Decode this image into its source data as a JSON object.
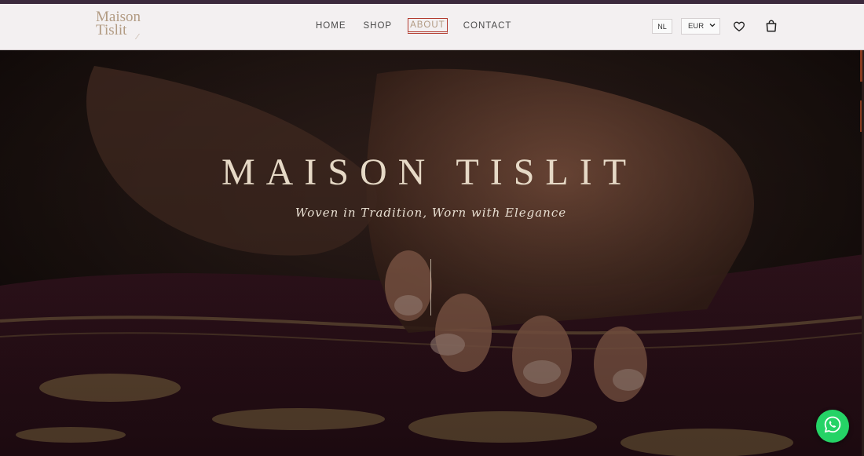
{
  "brand": {
    "line1": "Maison",
    "line2": "Tislit"
  },
  "nav": {
    "items": [
      {
        "label": "HOME"
      },
      {
        "label": "SHOP"
      },
      {
        "label": "ABOUT",
        "active": true
      },
      {
        "label": "CONTACT"
      }
    ]
  },
  "header_tools": {
    "language": "NL",
    "currency": "EUR",
    "icons": [
      "heart-icon",
      "shopping-bag-icon",
      "chevron-down-icon"
    ]
  },
  "hero": {
    "title": "MAISON TISLIT",
    "subtitle": "Woven in Tradition, Worn with Elegance"
  },
  "chat": {
    "icon": "whatsapp-icon"
  },
  "colors": {
    "accent_gold": "#b29b83",
    "active_border": "#b23a2e",
    "whatsapp_green": "#25d366",
    "header_bg": "#f3f0f1"
  }
}
